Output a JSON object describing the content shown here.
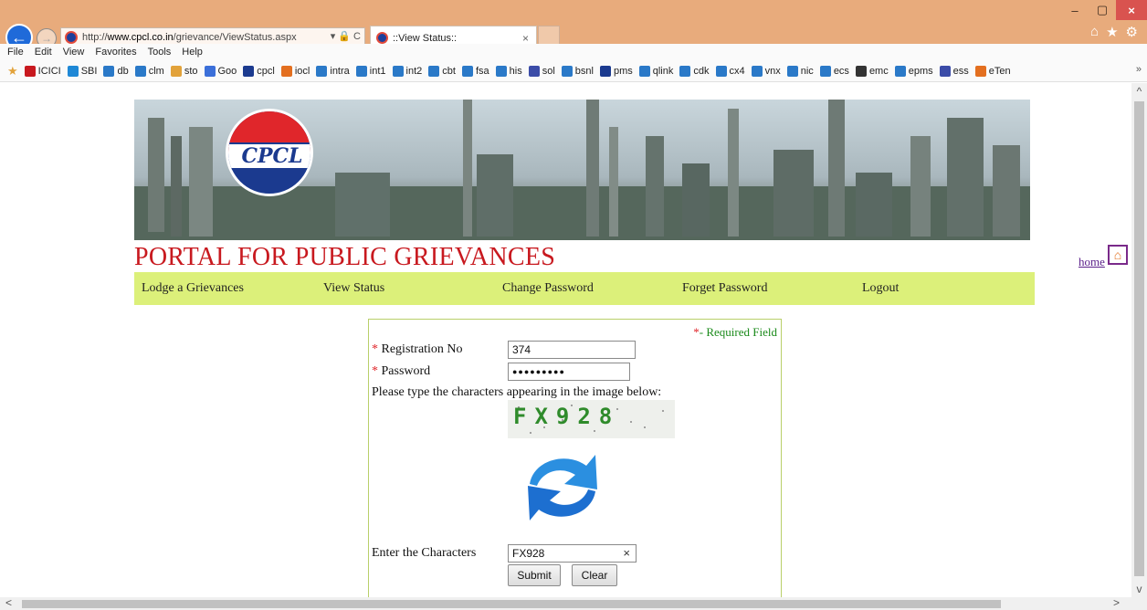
{
  "browser": {
    "url_prefix": "http://",
    "url_domain": "www.cpcl.co.in",
    "url_path": "/grievance/ViewStatus.aspx",
    "address_tools": "▾ 🔒 C",
    "tab_title": "::View Status::",
    "tab_close": "×",
    "window_controls": [
      "–",
      "▢",
      "×"
    ],
    "right_icons": [
      "⌂",
      "★",
      "⚙"
    ],
    "menu": [
      "File",
      "Edit",
      "View",
      "Favorites",
      "Tools",
      "Help"
    ],
    "favorites": [
      {
        "label": "ICICI",
        "color": "#c8191f"
      },
      {
        "label": "SBI",
        "color": "#1e88d6"
      },
      {
        "label": "db",
        "color": "#2a79c8"
      },
      {
        "label": "clm",
        "color": "#2a79c8"
      },
      {
        "label": "sto",
        "color": "#e2a23a"
      },
      {
        "label": "Goo",
        "color": "#3b6fd9"
      },
      {
        "label": "cpcl",
        "color": "#1b3a8f"
      },
      {
        "label": "iocl",
        "color": "#e36f1f"
      },
      {
        "label": "intra",
        "color": "#2a79c8"
      },
      {
        "label": "int1",
        "color": "#2a79c8"
      },
      {
        "label": "int2",
        "color": "#2a79c8"
      },
      {
        "label": "cbt",
        "color": "#2a79c8"
      },
      {
        "label": "fsa",
        "color": "#2a79c8"
      },
      {
        "label": "his",
        "color": "#2a79c8"
      },
      {
        "label": "sol",
        "color": "#3b4ca8"
      },
      {
        "label": "bsnl",
        "color": "#2a79c8"
      },
      {
        "label": "pms",
        "color": "#1b3a8f"
      },
      {
        "label": "qlink",
        "color": "#2a79c8"
      },
      {
        "label": "cdk",
        "color": "#2a79c8"
      },
      {
        "label": "cx4",
        "color": "#2a79c8"
      },
      {
        "label": "vnx",
        "color": "#2a79c8"
      },
      {
        "label": "nic",
        "color": "#2a79c8"
      },
      {
        "label": "ecs",
        "color": "#2a79c8"
      },
      {
        "label": "emc",
        "color": "#333333"
      },
      {
        "label": "epms",
        "color": "#2a79c8"
      },
      {
        "label": "ess",
        "color": "#3b4ca8"
      },
      {
        "label": "eTen",
        "color": "#e36f1f"
      }
    ],
    "favorites_more": "»"
  },
  "page": {
    "logo_text": "CPCL",
    "title": "PORTAL FOR PUBLIC GRIEVANCES",
    "home_link": "home",
    "nav": [
      {
        "label": "Lodge a Grievances"
      },
      {
        "label": "View Status"
      },
      {
        "label": "Change Password"
      },
      {
        "label": "Forget Password"
      },
      {
        "label": "Logout"
      }
    ]
  },
  "form": {
    "required_star": "*",
    "required_note": "- Required Field",
    "registration_label": "Registration No",
    "registration_value": "374",
    "password_label": "Password",
    "password_value": "●●●●●●●●●",
    "captcha_instruction": "Please type the characters appearing in the image below:",
    "captcha_text": "FX928",
    "enter_chars_label": "Enter the Characters",
    "enter_chars_value": "FX928",
    "clear_input_icon": "×",
    "submit_label": "Submit",
    "clear_label": "Clear"
  },
  "colors": {
    "title_red": "#c8191f",
    "nav_green": "#dcf07a",
    "required_green": "#1a8a1a",
    "chrome_orange": "#e8ab7c"
  },
  "scrollbars": {
    "up": "^",
    "down": "v",
    "left": "<",
    "right": ">"
  }
}
